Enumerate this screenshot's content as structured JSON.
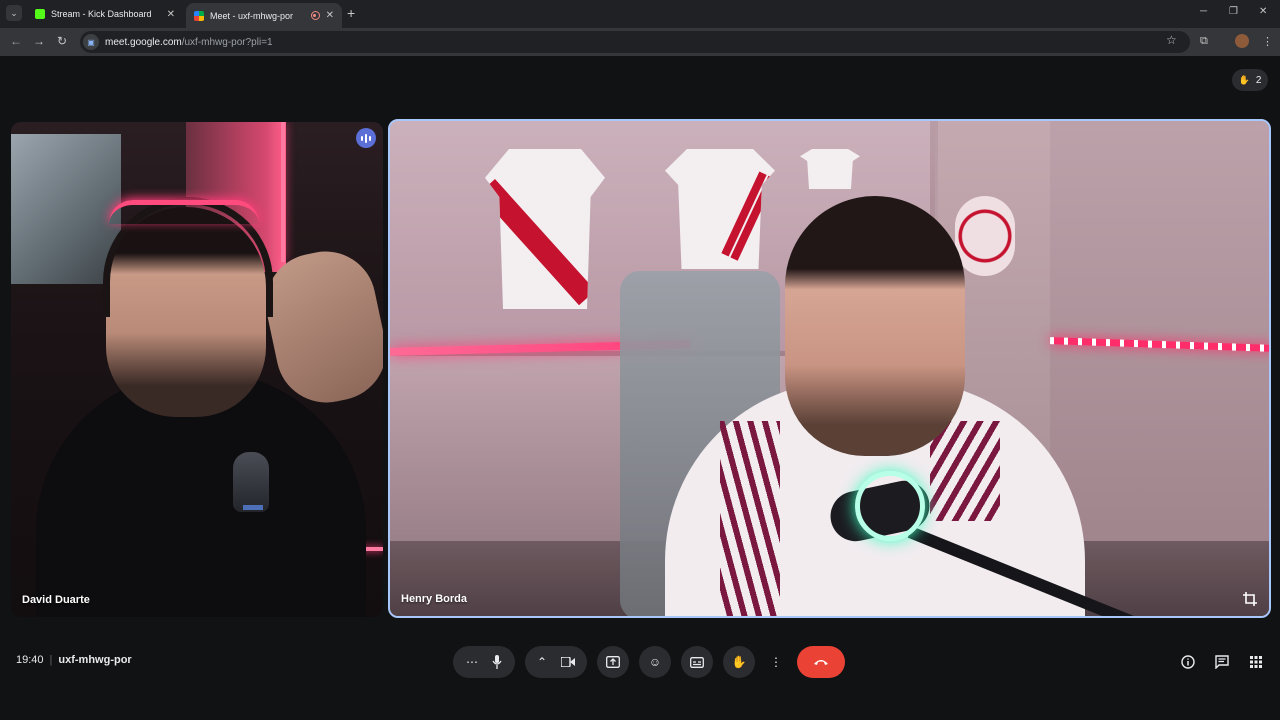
{
  "browser": {
    "tabs": [
      {
        "title": "Stream - Kick Dashboard",
        "favicon_color": "#53fc18"
      },
      {
        "title": "Meet - uxf-mhwg-por",
        "favicon_color": "#00ac47",
        "recording": true
      }
    ],
    "url_host": "meet.google.com",
    "url_path": "/uxf-mhwg-por?pli=1"
  },
  "meet": {
    "participants_count": "2",
    "tiles": [
      {
        "name": "David Duarte"
      },
      {
        "name": "Henry Borda"
      }
    ],
    "time": "19:40",
    "meeting_code": "uxf-mhwg-por"
  },
  "colors": {
    "accent": "#a8c7fa",
    "end_call": "#ea4335",
    "speaking_indicator": "#5b6fd6"
  }
}
